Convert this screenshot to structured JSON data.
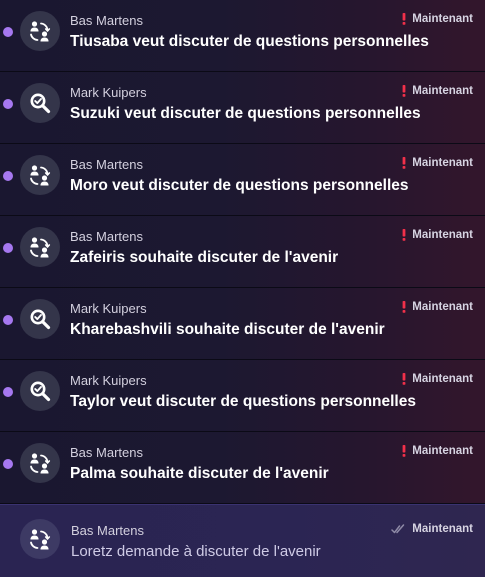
{
  "colors": {
    "unread_dot": "#a678f0",
    "urgent_mark": "#f2304a",
    "read_check": "#8e8aa6"
  },
  "messages": [
    {
      "sender": "Bas Martens",
      "subject": "Tiusaba veut discuter de questions personnelles",
      "time": "Maintenant",
      "icon": "people-icon",
      "status_icon": "exclamation-icon",
      "unread": true
    },
    {
      "sender": "Mark Kuipers",
      "subject": "Suzuki veut discuter de questions personnelles",
      "time": "Maintenant",
      "icon": "magnifier-icon",
      "status_icon": "exclamation-icon",
      "unread": true
    },
    {
      "sender": "Bas Martens",
      "subject": "Moro veut discuter de questions personnelles",
      "time": "Maintenant",
      "icon": "people-icon",
      "status_icon": "exclamation-icon",
      "unread": true
    },
    {
      "sender": "Bas Martens",
      "subject": "Zafeiris souhaite discuter de l'avenir",
      "time": "Maintenant",
      "icon": "people-icon",
      "status_icon": "exclamation-icon",
      "unread": true
    },
    {
      "sender": "Mark Kuipers",
      "subject": "Kharebashvili souhaite discuter de l'avenir",
      "time": "Maintenant",
      "icon": "magnifier-icon",
      "status_icon": "exclamation-icon",
      "unread": true
    },
    {
      "sender": "Mark Kuipers",
      "subject": "Taylor veut discuter de questions personnelles",
      "time": "Maintenant",
      "icon": "magnifier-icon",
      "status_icon": "exclamation-icon",
      "unread": true
    },
    {
      "sender": "Bas Martens",
      "subject": "Palma souhaite discuter de l'avenir",
      "time": "Maintenant",
      "icon": "people-icon",
      "status_icon": "exclamation-icon",
      "unread": true
    },
    {
      "sender": "Bas Martens",
      "subject": "Loretz demande à discuter de l'avenir",
      "time": "Maintenant",
      "icon": "people-icon",
      "status_icon": "double-check-icon",
      "unread": false
    }
  ]
}
